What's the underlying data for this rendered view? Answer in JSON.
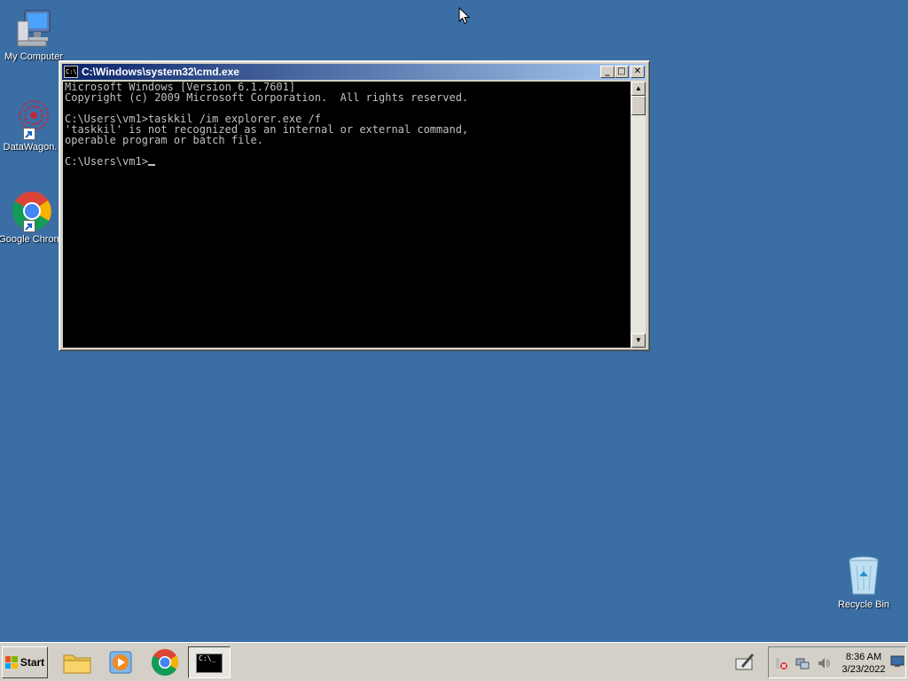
{
  "desktop": {
    "icons": [
      {
        "label": "My Computer"
      },
      {
        "label": "DataWagon."
      },
      {
        "label": "Google Chrom"
      },
      {
        "label": "Recycle Bin"
      }
    ]
  },
  "window": {
    "title": "C:\\Windows\\system32\\cmd.exe",
    "icon_text": "C:\\",
    "buttons": {
      "minimize": "_",
      "maximize": "□",
      "close": "✕"
    },
    "console_lines": [
      "Microsoft Windows [Version 6.1.7601]",
      "Copyright (c) 2009 Microsoft Corporation.  All rights reserved.",
      "",
      "C:\\Users\\vm1>taskkil /im explorer.exe /f",
      "'taskkil' is not recognized as an internal or external command,",
      "operable program or batch file.",
      "",
      "C:\\Users\\vm1>"
    ],
    "scroll_up": "▲",
    "scroll_down": "▼"
  },
  "taskbar": {
    "start_label": "Start",
    "active_task_icon_text": "C:\\_",
    "clock_time": "8:36 AM",
    "clock_date": "3/23/2022"
  },
  "colors": {
    "desktop": "#3a6ea5",
    "titlebar_start": "#0a246a",
    "titlebar_end": "#a6caf0",
    "console_bg": "#000000",
    "console_fg": "#c0c0c0"
  }
}
